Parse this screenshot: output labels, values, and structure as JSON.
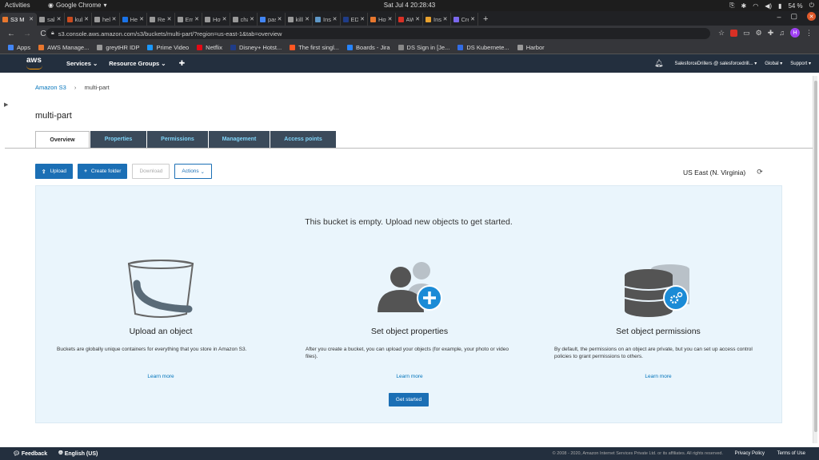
{
  "os": {
    "activities": "Activities",
    "app": "Google Chrome",
    "clock": "Sat Jul 4  20:28:43",
    "battery": "54 %"
  },
  "tabs": [
    {
      "label": "S3 M",
      "color": "#e8772e"
    },
    {
      "label": "sales",
      "color": "#999"
    },
    {
      "label": "kube",
      "color": "#c94b1f"
    },
    {
      "label": "helm",
      "color": "#999"
    },
    {
      "label": "Helm",
      "color": "#1a73e8"
    },
    {
      "label": "Relea",
      "color": "#999"
    },
    {
      "label": "Error",
      "color": "#999"
    },
    {
      "label": "How",
      "color": "#999"
    },
    {
      "label": "chart",
      "color": "#999"
    },
    {
      "label": "pass",
      "color": "#4285f4"
    },
    {
      "label": "killbi",
      "color": "#999"
    },
    {
      "label": "Insta",
      "color": "#5e97c7"
    },
    {
      "label": "ED bi",
      "color": "#1f3c88"
    },
    {
      "label": "How",
      "color": "#e8772e"
    },
    {
      "label": "AWS",
      "color": "#d93025"
    },
    {
      "label": "Insta",
      "color": "#e8a12e"
    },
    {
      "label": "Creat",
      "color": "#7b68ee"
    }
  ],
  "browser": {
    "url": "s3.console.aws.amazon.com/s3/buckets/multi-part/?region=us-east-1&tab=overview",
    "avatar": "H"
  },
  "bookmarks": [
    {
      "label": "Apps",
      "color": "#4285f4"
    },
    {
      "label": "AWS Manage...",
      "color": "#e8772e"
    },
    {
      "label": "greytHR IDP",
      "color": "#999"
    },
    {
      "label": "Prime Video",
      "color": "#1a98ff"
    },
    {
      "label": "Netflix",
      "color": "#e50914"
    },
    {
      "label": "Disney+ Hotst...",
      "color": "#1f3c88"
    },
    {
      "label": "The first singl...",
      "color": "#ff5722"
    },
    {
      "label": "Boards - Jira",
      "color": "#2684ff"
    },
    {
      "label": "DS Sign in [Je...",
      "color": "#888"
    },
    {
      "label": "DS Kubernete...",
      "color": "#326ce5"
    },
    {
      "label": "Harbor",
      "color": "#999"
    }
  ],
  "aws": {
    "logo": "aws",
    "services": "Services",
    "resource_groups": "Resource Groups",
    "account": "SalesforceDrillers @ salesforcedrill...",
    "region": "Global",
    "support": "Support"
  },
  "page": {
    "crumb_root": "Amazon S3",
    "crumb_current": "multi-part",
    "title": "multi-part",
    "tabs": [
      "Overview",
      "Properties",
      "Permissions",
      "Management",
      "Access points"
    ],
    "buttons": {
      "upload": "Upload",
      "create_folder": "Create folder",
      "download": "Download",
      "actions": "Actions"
    },
    "region": "US East (N. Virginia)",
    "empty_message": "This bucket is empty. Upload new objects to get started.",
    "columns": [
      {
        "title": "Upload an object",
        "text": "Buckets are globally unique containers for everything that you store in Amazon S3.",
        "link": "Learn more"
      },
      {
        "title": "Set object properties",
        "text": "After you create a bucket, you can upload your objects (for example, your photo or video files).",
        "link": "Learn more"
      },
      {
        "title": "Set object permissions",
        "text": "By default, the permissions on an object are private, but you can set up access control policies to grant permissions to others.",
        "link": "Learn more"
      }
    ],
    "get_started": "Get started"
  },
  "footer": {
    "feedback": "Feedback",
    "language": "English (US)",
    "copyright": "© 2008 - 2020, Amazon Internet Services Private Ltd. or its affiliates. All rights reserved.",
    "privacy": "Privacy Policy",
    "terms": "Terms of Use"
  }
}
